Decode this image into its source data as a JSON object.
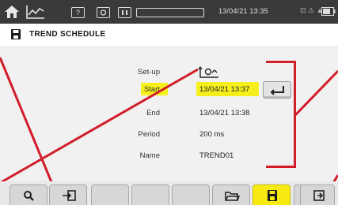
{
  "status_bar": {
    "home_icon": "home-icon",
    "trend_icon": "trend-mode-icon",
    "help_label": "?",
    "camera_icon": "camera-icon",
    "pause_icon": "pause-icon",
    "datetime": "13/04/21 13:35",
    "status_text": "⊡ ⚠ ▲",
    "battery_icon": "battery-icon"
  },
  "title_bar": {
    "icon": "save-disk-icon",
    "title": "TREND SCHEDULE"
  },
  "form": {
    "setup_label": "Set-up",
    "setup_icon": "trend-config-icon",
    "start_label": "Start",
    "start_value": "13/04/21 13:37",
    "end_label": "End",
    "end_value": "13/04/21 13:38",
    "period_label": "Period",
    "period_value": "200 ms",
    "name_label": "Name",
    "name_value": "TREND01",
    "enter_icon": "enter-key-icon"
  },
  "colors": {
    "highlight": "#f6ef1c",
    "annotation": "#d11e2a",
    "status_bar": "#3a3a3a"
  },
  "function_keys": [
    {
      "icon": "magnifier-icon",
      "active": false
    },
    {
      "icon": "export-icon",
      "active": false
    },
    {
      "icon": "",
      "active": false
    },
    {
      "icon": "",
      "active": false
    },
    {
      "icon": "",
      "active": false
    },
    {
      "icon": "folder-open-icon",
      "active": false
    },
    {
      "icon": "save-disk-icon",
      "active": true
    },
    {
      "icon": "",
      "active": false
    },
    {
      "icon": "exit-icon",
      "active": false
    }
  ]
}
